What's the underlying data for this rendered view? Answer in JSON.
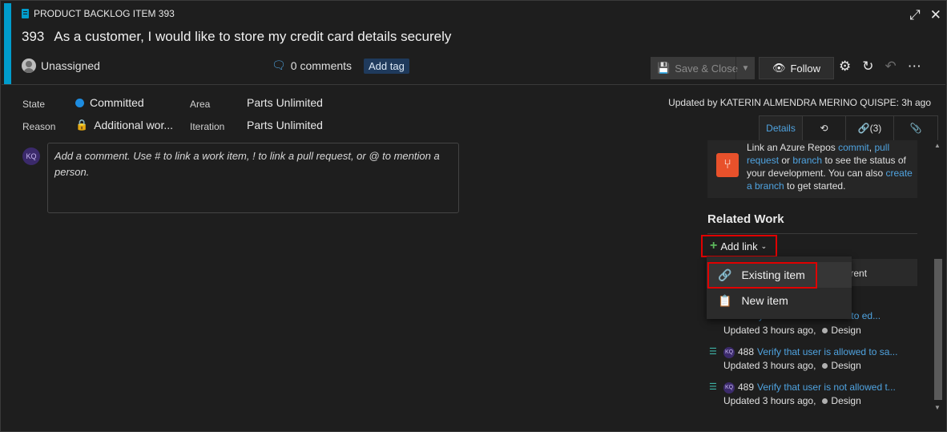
{
  "header": {
    "type_label": "PRODUCT BACKLOG ITEM 393",
    "id": "393",
    "title": "As a customer, I would like to store my credit card details securely",
    "assigned": "Unassigned",
    "comments": "0 comments",
    "add_tag": "Add tag",
    "save_close": "Save & Close",
    "follow": "Follow"
  },
  "fields": {
    "state_label": "State",
    "state_value": "Committed",
    "reason_label": "Reason",
    "reason_value": "Additional wor...",
    "area_label": "Area",
    "area_value": "Parts Unlimited",
    "iteration_label": "Iteration",
    "iteration_value": "Parts Unlimited",
    "updated_by": "Updated by KATERIN ALMENDRA MERINO QUISPE: 3h ago"
  },
  "tabs": {
    "details": "Details",
    "links": "(3)"
  },
  "comment": {
    "avatar_initials": "KQ",
    "placeholder": "Add a comment. Use # to link a work item, ! to link a pull request, or @ to mention a person."
  },
  "development": {
    "text_1": "Link an Azure Repos",
    "link_commit": "commit",
    "link_pr": "pull request",
    "text_or": "or",
    "link_branch": "branch",
    "text_2": "to see the status of your development. You can also",
    "link_create_branch": "create a branch",
    "text_3": "to get started."
  },
  "related": {
    "title": "Related Work",
    "add_link": "Add link",
    "parent_partial": "parent",
    "menu": {
      "existing": "Existing item",
      "new": "New item"
    },
    "partial_title": "Verify that user is allowed to ed...",
    "items": [
      {
        "updated": "Updated 3 hours ago,",
        "state": "Design"
      },
      {
        "id": "488",
        "title": "Verify that user is allowed to sa...",
        "updated": "Updated 3 hours ago,",
        "state": "Design"
      },
      {
        "id": "489",
        "title": "Verify that user is not allowed t...",
        "updated": "Updated 3 hours ago,",
        "state": "Design"
      }
    ]
  },
  "colors": {
    "accent": "#009ccc",
    "committed_dot": "#1d8ce0",
    "link": "#4fa3e0",
    "highlight": "#e00000",
    "add_plus": "#5cb85c",
    "repo_icon": "#e8512b"
  }
}
